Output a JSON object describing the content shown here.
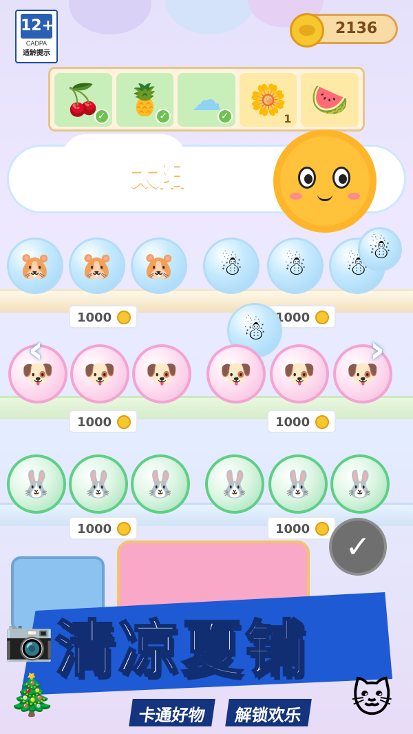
{
  "rating": {
    "age": "12+",
    "org": "CADPA",
    "label": "适龄提示"
  },
  "coins": {
    "value": "2136"
  },
  "categories": [
    {
      "name": "cherry",
      "icon": "🍒",
      "checked": true
    },
    {
      "name": "pineapple",
      "icon": "🍍",
      "checked": true
    },
    {
      "name": "cloud",
      "icon": "☁",
      "checked": true
    },
    {
      "name": "sun",
      "icon": "🌼",
      "count": "1"
    },
    {
      "name": "watermelon",
      "icon": "🍉"
    }
  ],
  "section_title": "太阳",
  "shelves": [
    {
      "items": [
        "🐹",
        "🐹",
        "🐹",
        "☃",
        "☃",
        "☃",
        "☃"
      ],
      "prices": [
        "1000",
        "1000"
      ]
    },
    {
      "items": [
        "🐶",
        "🐶",
        "🐶",
        "🐶",
        "🐶",
        "🐶"
      ],
      "prices": [
        "1000",
        "1000"
      ]
    },
    {
      "items": [
        "🐰",
        "🐰",
        "🐰",
        "🐰",
        "🐰",
        "🐰"
      ],
      "prices": [
        "1000",
        "1000"
      ]
    }
  ],
  "dragged_item": "☃",
  "nav": {
    "prev": "‹",
    "next": "›"
  },
  "confirm": "✓",
  "banner": {
    "title": "清凉夏铺",
    "tag1": "卡通好物",
    "tag2": "解锁欢乐"
  }
}
